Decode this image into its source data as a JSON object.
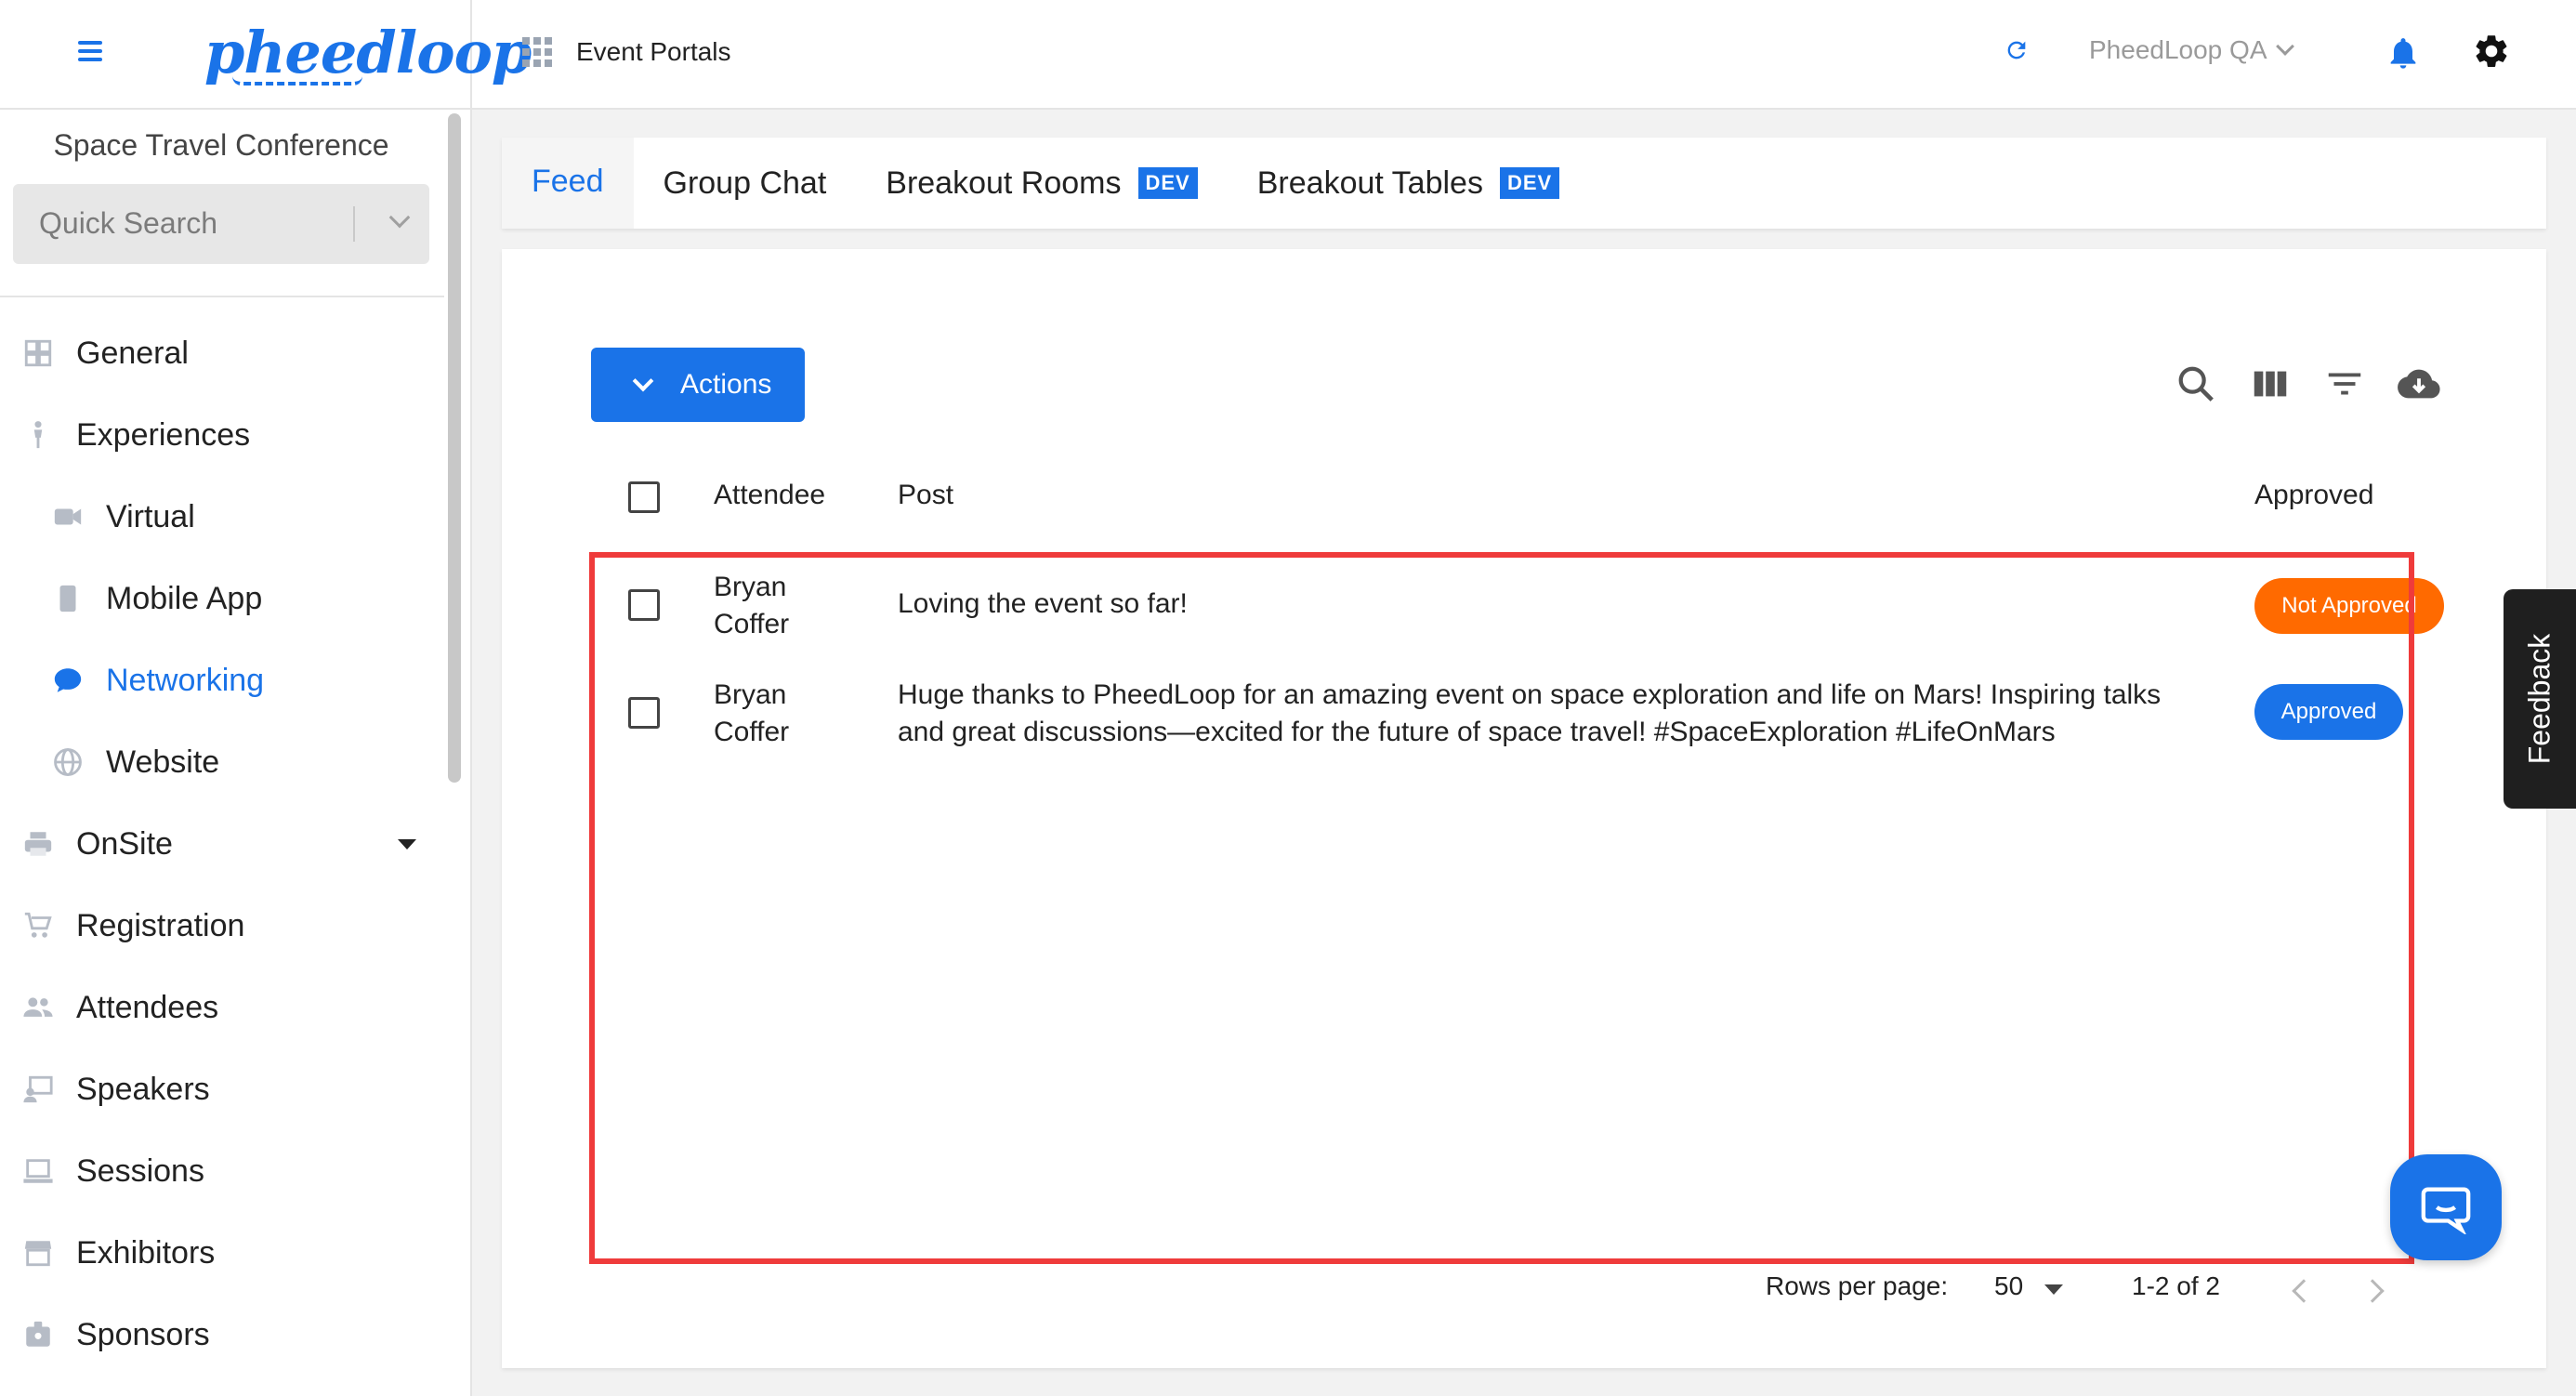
{
  "header": {
    "logo_text": "pheedloop",
    "portal_label": "Event Portals",
    "org_name": "PheedLoop QA"
  },
  "sidebar": {
    "event_name": "Space Travel Conference",
    "search_placeholder": "Quick Search",
    "items": [
      {
        "label": "General",
        "icon": "grid-icon"
      },
      {
        "label": "Experiences",
        "icon": "person-icon"
      },
      {
        "label": "Virtual",
        "icon": "video-camera-icon"
      },
      {
        "label": "Mobile App",
        "icon": "phone-icon"
      },
      {
        "label": "Networking",
        "icon": "chat-bubble-icon"
      },
      {
        "label": "Website",
        "icon": "globe-icon"
      },
      {
        "label": "OnSite",
        "icon": "printer-icon"
      },
      {
        "label": "Registration",
        "icon": "cart-icon"
      },
      {
        "label": "Attendees",
        "icon": "people-icon"
      },
      {
        "label": "Speakers",
        "icon": "presenter-icon"
      },
      {
        "label": "Sessions",
        "icon": "laptop-icon"
      },
      {
        "label": "Exhibitors",
        "icon": "storefront-icon"
      },
      {
        "label": "Sponsors",
        "icon": "badge-icon"
      }
    ]
  },
  "tabs": [
    {
      "label": "Feed",
      "active": true
    },
    {
      "label": "Group Chat"
    },
    {
      "label": "Breakout Rooms",
      "badge": "DEV"
    },
    {
      "label": "Breakout Tables",
      "badge": "DEV"
    }
  ],
  "toolbar": {
    "actions_label": "Actions",
    "tools": [
      "search-icon",
      "columns-icon",
      "filter-icon",
      "cloud-download-icon"
    ]
  },
  "table": {
    "columns": [
      "Attendee",
      "Post",
      "Approved"
    ],
    "rows": [
      {
        "attendee_line1": "Bryan",
        "attendee_line2": "Coffer",
        "post_line1": "Loving the event so far!",
        "post_line2": "",
        "status": "Not Approved"
      },
      {
        "attendee_line1": "Bryan",
        "attendee_line2": "Coffer",
        "post_line1": "Huge thanks to PheedLoop for an amazing event on space exploration and life on Mars! Inspiring talks",
        "post_line2": "and great discussions—excited for the future of space travel! #SpaceExploration #LifeOnMars",
        "status": "Approved"
      }
    ]
  },
  "pagination": {
    "rows_per_page_label": "Rows per page:",
    "rows_per_page_value": "50",
    "range": "1-2 of 2"
  },
  "feedback_label": "Feedback",
  "colors": {
    "accent": "#1a73e8",
    "not_approved": "#ff6a00",
    "approved": "#1a73e8",
    "highlight": "#ef3b3b"
  }
}
